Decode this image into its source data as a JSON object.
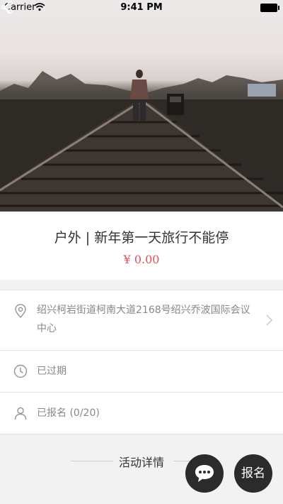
{
  "status_bar": {
    "carrier": "Carrier",
    "time": "9:41 PM"
  },
  "event": {
    "title": "户外 | 新年第一天旅行不能停",
    "price": "¥ 0.00"
  },
  "info": {
    "address": "绍兴柯岩街道柯南大道2168号绍兴乔波国际会议中心",
    "status": "已过期",
    "signup": "已报名 (0/20)"
  },
  "details_section": {
    "label": "活动详情"
  },
  "actions": {
    "signup_label": "报名"
  },
  "colors": {
    "price": "#e0505a",
    "fab": "#2b2b2b"
  }
}
